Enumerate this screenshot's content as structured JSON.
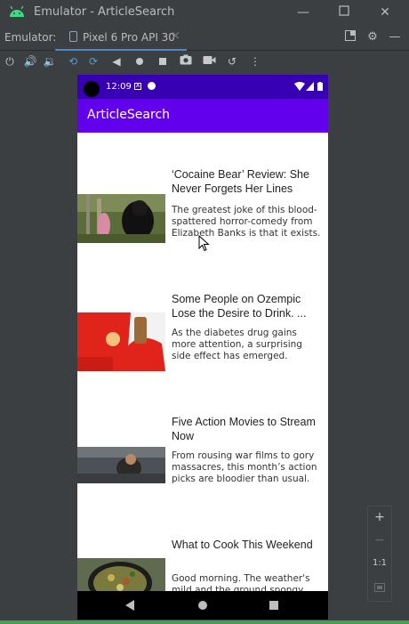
{
  "window": {
    "title": "Emulator - ArticleSearch"
  },
  "tabbar": {
    "label": "Emulator:",
    "device_tab": "Pixel 6 Pro API 30",
    "close_glyph": "×"
  },
  "toolbar": {
    "icons": [
      "power-icon",
      "volume-up-icon",
      "volume-down-icon",
      "rotate-left-icon",
      "rotate-right-icon",
      "back-icon",
      "home-icon",
      "overview-icon",
      "screenshot-icon",
      "record-icon",
      "snapshot-icon",
      "more-icon"
    ]
  },
  "phone": {
    "status_time": "12:09",
    "app_title": "ArticleSearch",
    "articles": [
      {
        "headline": "‘Cocaine Bear’ Review: She Never Forgets Her Lines",
        "snippet": "The greatest joke of this blood-spattered horror-comedy from Elizabeth Banks is that it exists."
      },
      {
        "headline": "Some People on Ozempic Lose the Desire to Drink. ...",
        "snippet": "As the diabetes drug gains more attention, a surprising side effect has emerged."
      },
      {
        "headline": "Five Action Movies to Stream Now",
        "snippet": "From rousing war films to gory massacres, this month’s action picks are bloodier than usual."
      },
      {
        "headline": "What to Cook This Weekend",
        "snippet": "Good morning. The weather's mild and the ground spongy where I"
      }
    ]
  },
  "sidepanel": {
    "zoom_in": "+",
    "zoom_out": "−",
    "one_to_one": "1:1"
  },
  "colors": {
    "status_bar": "#3700b3",
    "app_bar": "#6200ee",
    "ide_background": "#3c3f41",
    "tab_underline": "#4a88c7"
  }
}
